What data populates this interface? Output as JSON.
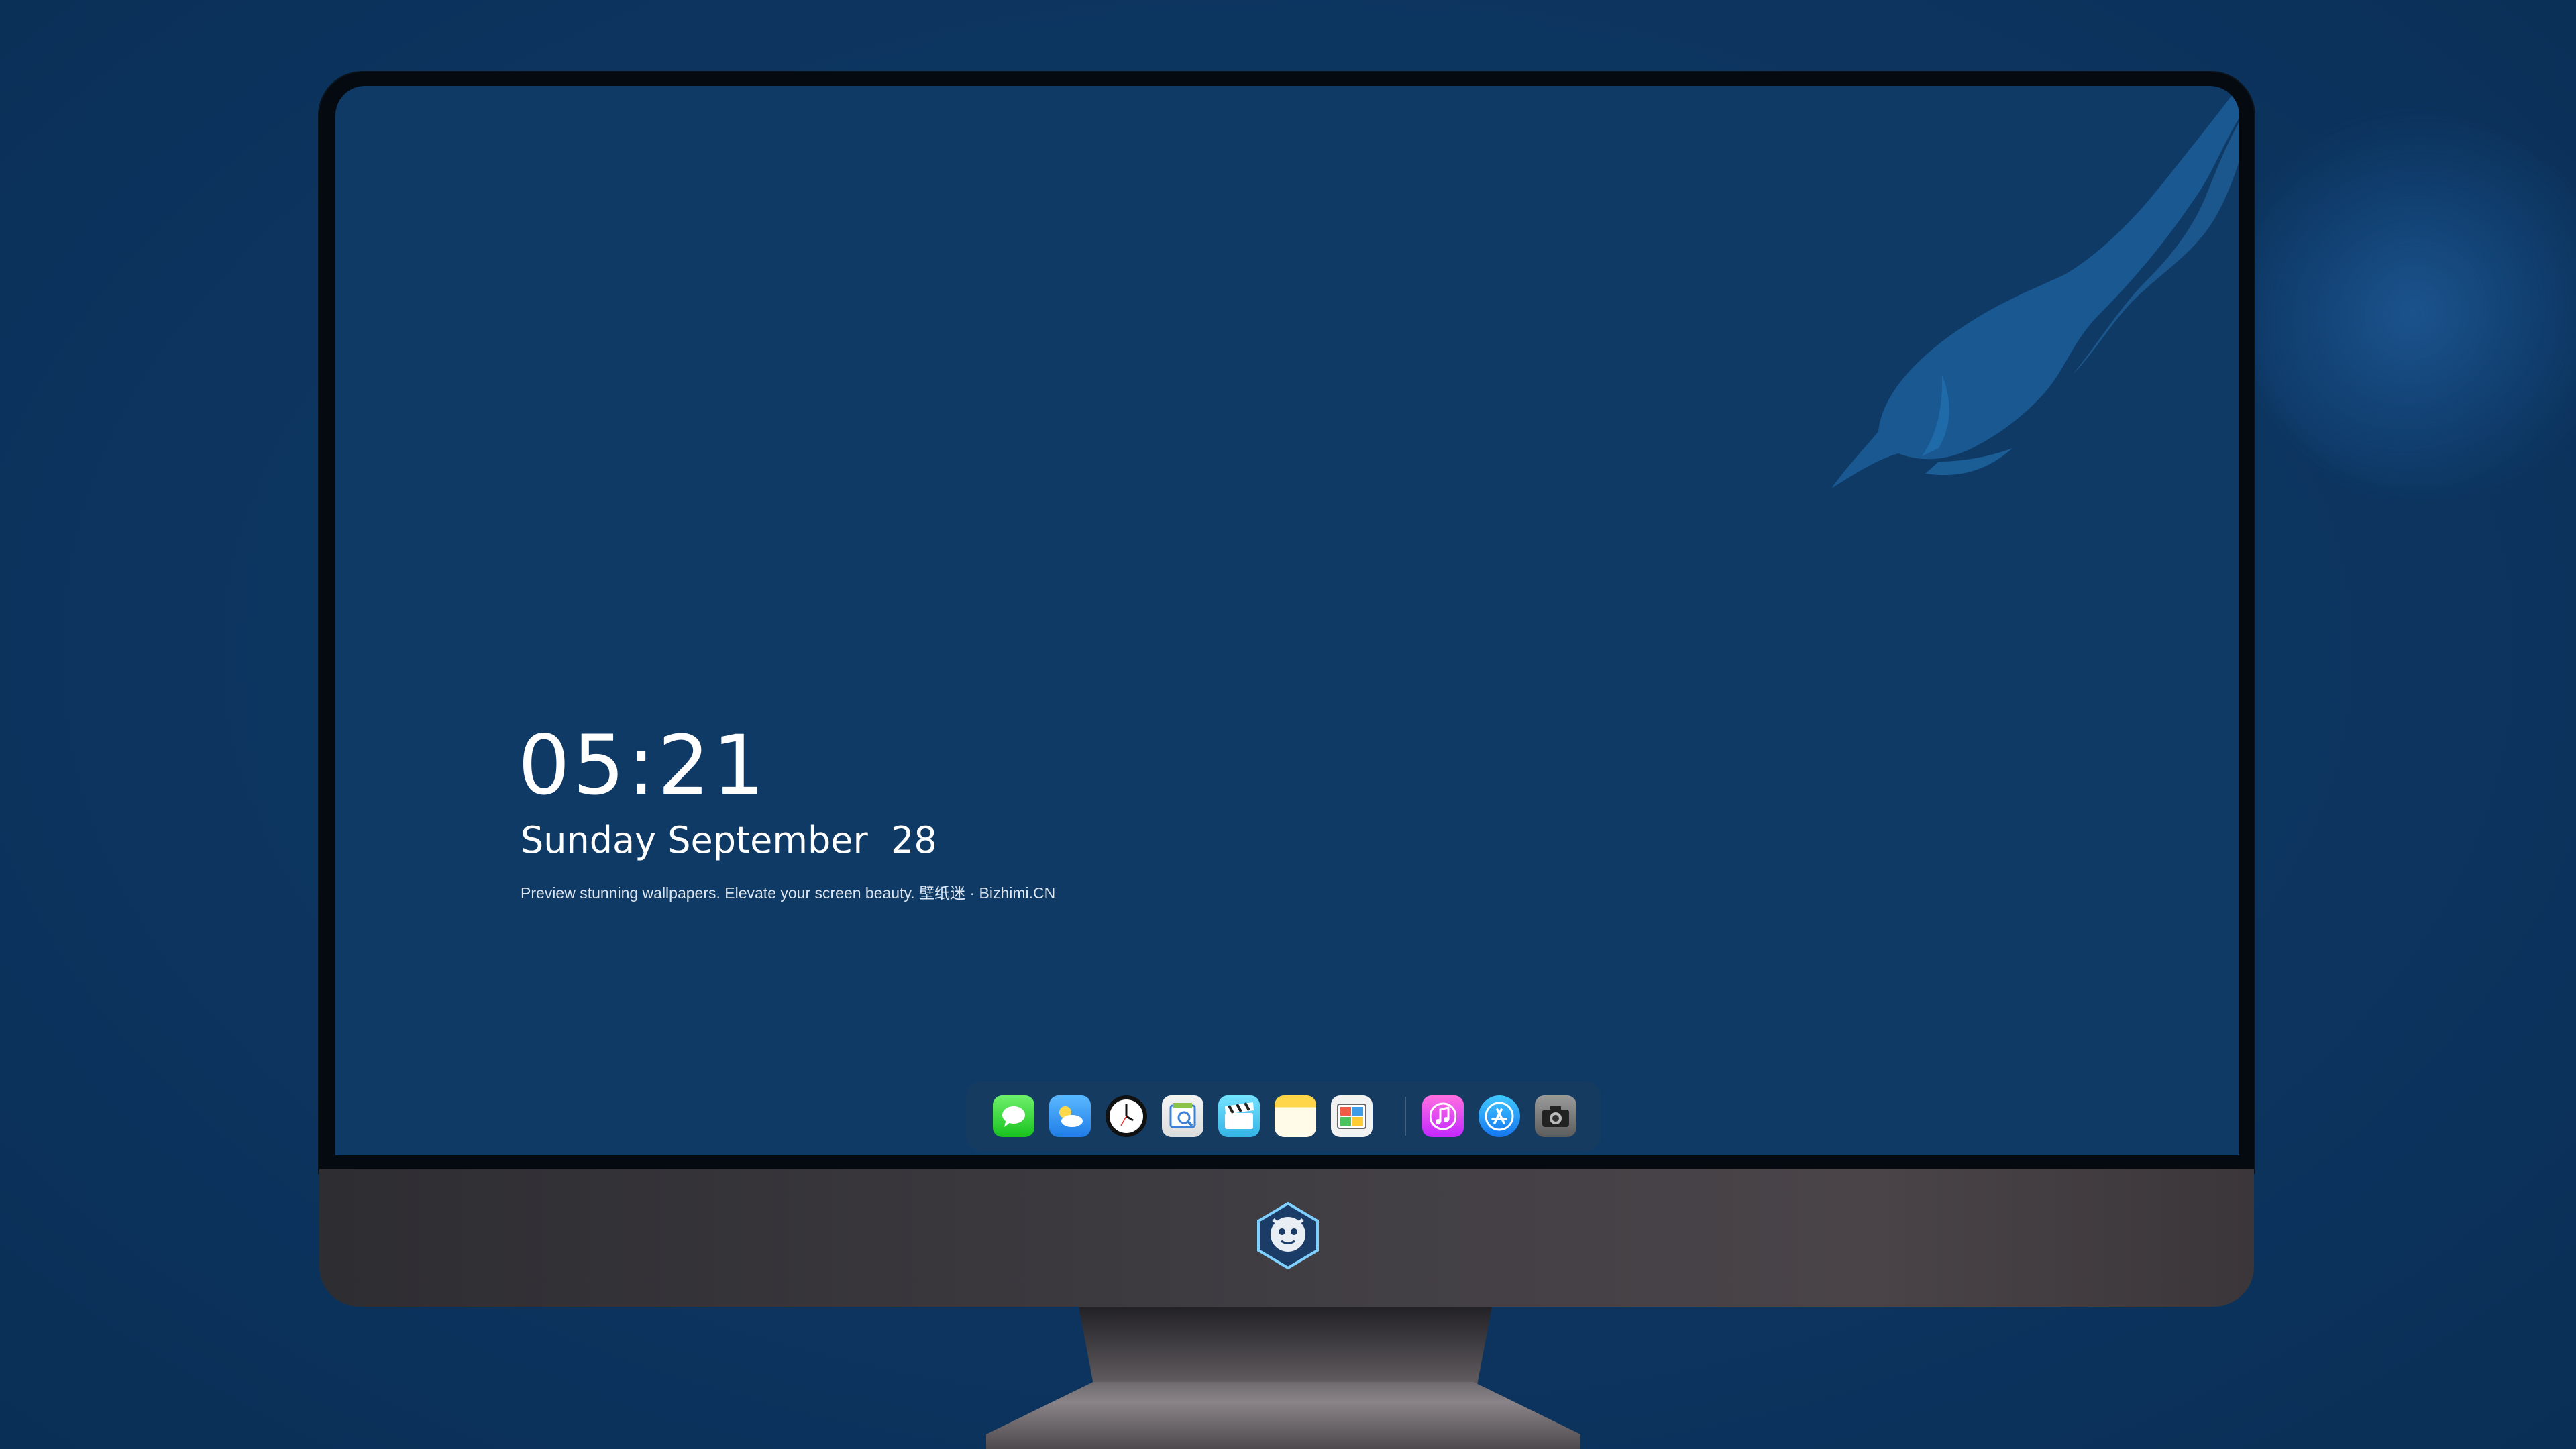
{
  "lock_screen": {
    "time": "05:21",
    "date": "Sunday September  28",
    "tagline": "Preview stunning wallpapers. Elevate your screen beauty. 壁纸迷 · Bizhimi.CN"
  },
  "dock": {
    "apps": [
      {
        "name": "Messages",
        "icon": "messages-icon"
      },
      {
        "name": "Weather",
        "icon": "weather-icon"
      },
      {
        "name": "Clock",
        "icon": "clock-icon"
      },
      {
        "name": "Preview",
        "icon": "preview-icon"
      },
      {
        "name": "Clips",
        "icon": "clips-icon"
      },
      {
        "name": "Notes",
        "icon": "notes-icon"
      },
      {
        "name": "Photo Booth",
        "icon": "photos-icon"
      },
      {
        "name": "Music",
        "icon": "music-icon"
      },
      {
        "name": "App Store",
        "icon": "app-store-icon"
      },
      {
        "name": "Camera",
        "icon": "camera-icon"
      }
    ]
  },
  "colors": {
    "background": "#0d3660",
    "screen": "#0f3a65",
    "fish": "#1a5a93",
    "text": "#ffffff"
  }
}
